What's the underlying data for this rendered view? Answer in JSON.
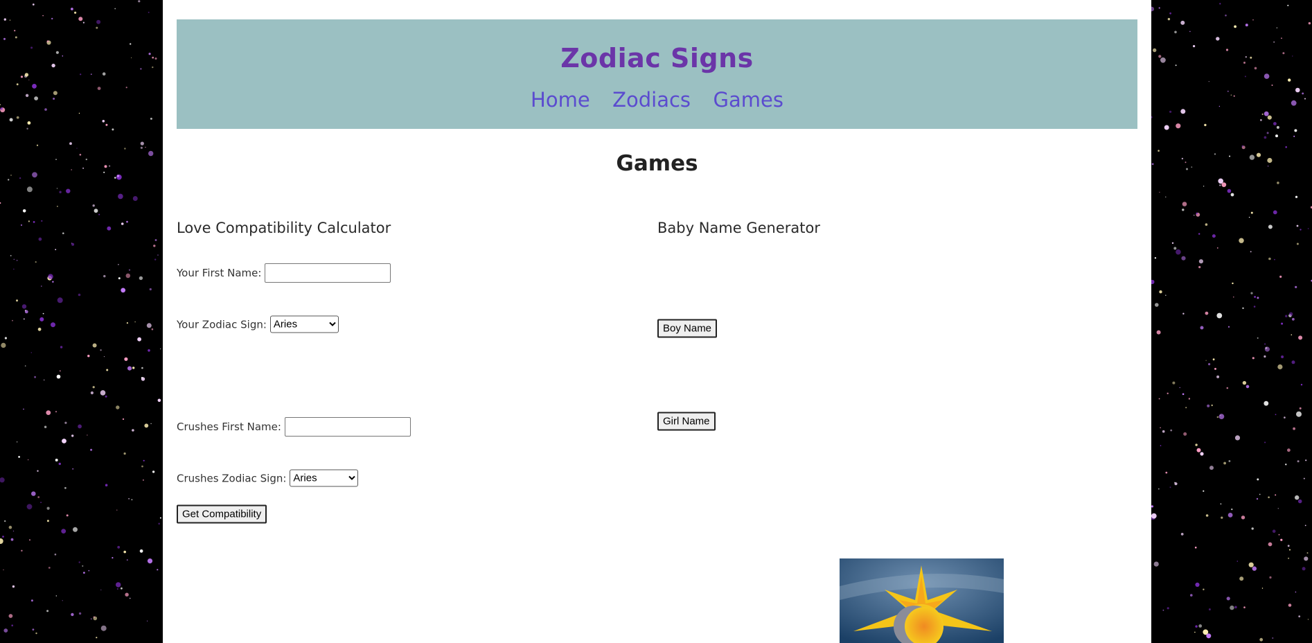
{
  "site": {
    "title": "Zodiac Signs",
    "nav": [
      "Home",
      "Zodiacs",
      "Games"
    ]
  },
  "page": {
    "heading": "Games"
  },
  "love_calculator": {
    "title": "Love Compatibility Calculator",
    "your_name_label": "Your First Name:",
    "your_name_value": "",
    "your_sign_label": "Your Zodiac Sign:",
    "your_sign_selected": "Aries",
    "crush_name_label": "Crushes First Name:",
    "crush_name_value": "",
    "crush_sign_label": "Crushes Zodiac Sign:",
    "crush_sign_selected": "Aries",
    "submit_label": "Get Compatibility"
  },
  "baby_name_generator": {
    "title": "Baby Name Generator",
    "boy_button": "Boy Name",
    "girl_button": "Girl Name"
  },
  "colors": {
    "background": "#000000",
    "header_bg": "#9bc0c2",
    "title": "#6b35a8",
    "nav_link": "#5b4bcf"
  },
  "icons": {
    "image": "sun-moon-illustration"
  }
}
